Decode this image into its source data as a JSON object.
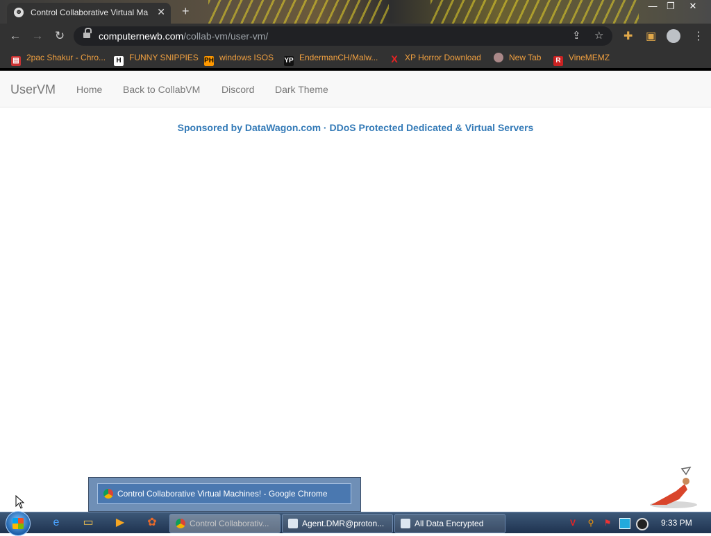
{
  "browser": {
    "tab_title": "Control Collaborative Virtual Ma",
    "url_host": "computernewb.com",
    "url_path": "/collab-vm/user-vm/",
    "bookmarks": [
      {
        "label": "2pac Shakur - Chro...",
        "icon": "printer-icon"
      },
      {
        "label": "FUNNY SNIPPIES",
        "icon": "H"
      },
      {
        "label": "windows ISOS",
        "icon": "PH"
      },
      {
        "label": "EndermanCH/Malw...",
        "icon": "YP"
      },
      {
        "label": "XP Horror Download",
        "icon": "X"
      },
      {
        "label": "New Tab",
        "icon": "globe-icon"
      },
      {
        "label": "VineMEMZ",
        "icon": "R"
      }
    ]
  },
  "page": {
    "brand": "UserVM",
    "nav": [
      "Home",
      "Back to CollabVM",
      "Discord",
      "Dark Theme"
    ],
    "sponsor": "Sponsored by DataWagon.com · DDoS Protected Dedicated & Virtual Servers"
  },
  "taskbar": {
    "preview_title": "Control Collaborative Virtual Machines! - Google Chrome",
    "buttons": [
      {
        "label": "Control Collaborativ...",
        "active": true
      },
      {
        "label": "Agent.DMR@proton...",
        "active": false
      },
      {
        "label": "All Data Encrypted",
        "active": false
      }
    ],
    "clock": "9:33 PM"
  },
  "colors": {
    "link": "#337ab7",
    "bookmark_text": "#f0a040",
    "chrome_dark": "#323232"
  }
}
